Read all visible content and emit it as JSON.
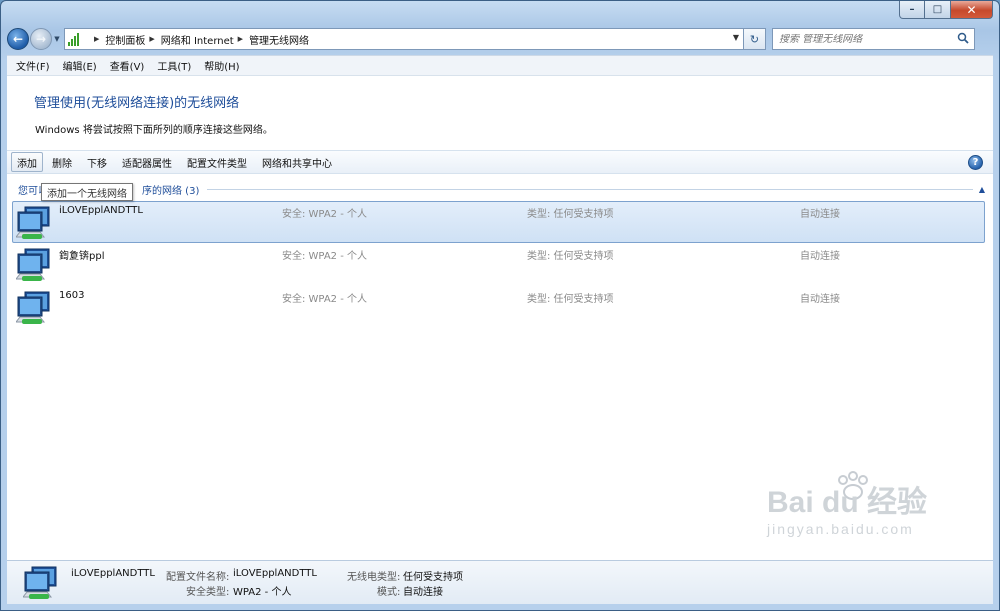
{
  "window": {
    "caption_buttons": {
      "minimize": "–",
      "maximize": "□",
      "close": "✕"
    }
  },
  "nav": {
    "back_glyph": "←",
    "forward_glyph": "→",
    "breadcrumb": [
      "控制面板",
      "网络和 Internet",
      "管理无线网络"
    ],
    "refresh_glyph": "↻",
    "search_placeholder": "搜索 管理无线网络"
  },
  "menu": [
    "文件(F)",
    "编辑(E)",
    "查看(V)",
    "工具(T)",
    "帮助(H)"
  ],
  "page": {
    "title": "管理使用(无线网络连接)的无线网络",
    "description": "Windows 将尝试按照下面所列的顺序连接这些网络。"
  },
  "toolbar": {
    "buttons": [
      "添加",
      "删除",
      "下移",
      "适配器属性",
      "配置文件类型",
      "网络和共享中心"
    ],
    "help_glyph": "?"
  },
  "group": {
    "title_start": "您可以",
    "title_end": "序的网络 (3)"
  },
  "tooltip": "添加一个无线网络",
  "networks": [
    {
      "name": "iLOVEpplANDTTL",
      "security": "安全: WPA2 - 个人",
      "type": "类型: 任何受支持项",
      "mode": "自动连接"
    },
    {
      "name": "鍧夐锛ppl",
      "security": "安全: WPA2 - 个人",
      "type": "类型: 任何受支持项",
      "mode": "自动连接"
    },
    {
      "name": "1603",
      "security": "安全: WPA2 - 个人",
      "type": "类型: 任何受支持项",
      "mode": "自动连接"
    }
  ],
  "details": {
    "name": "iLOVEpplANDTTL",
    "profile_label": "配置文件名称:",
    "profile_value": "iLOVEpplANDTTL",
    "security_label": "安全类型:",
    "security_value": "WPA2 - 个人",
    "radio_label": "无线电类型:",
    "radio_value": "任何受支持项",
    "mode_label": "模式:",
    "mode_value": "自动连接"
  },
  "watermark": {
    "brand": "Bai du 经验",
    "url": "jingyan.baidu.com"
  },
  "colors": {
    "accent": "#1f4e9a",
    "selection": "#cfe1f5",
    "title_bar": "#a9c6e6"
  }
}
